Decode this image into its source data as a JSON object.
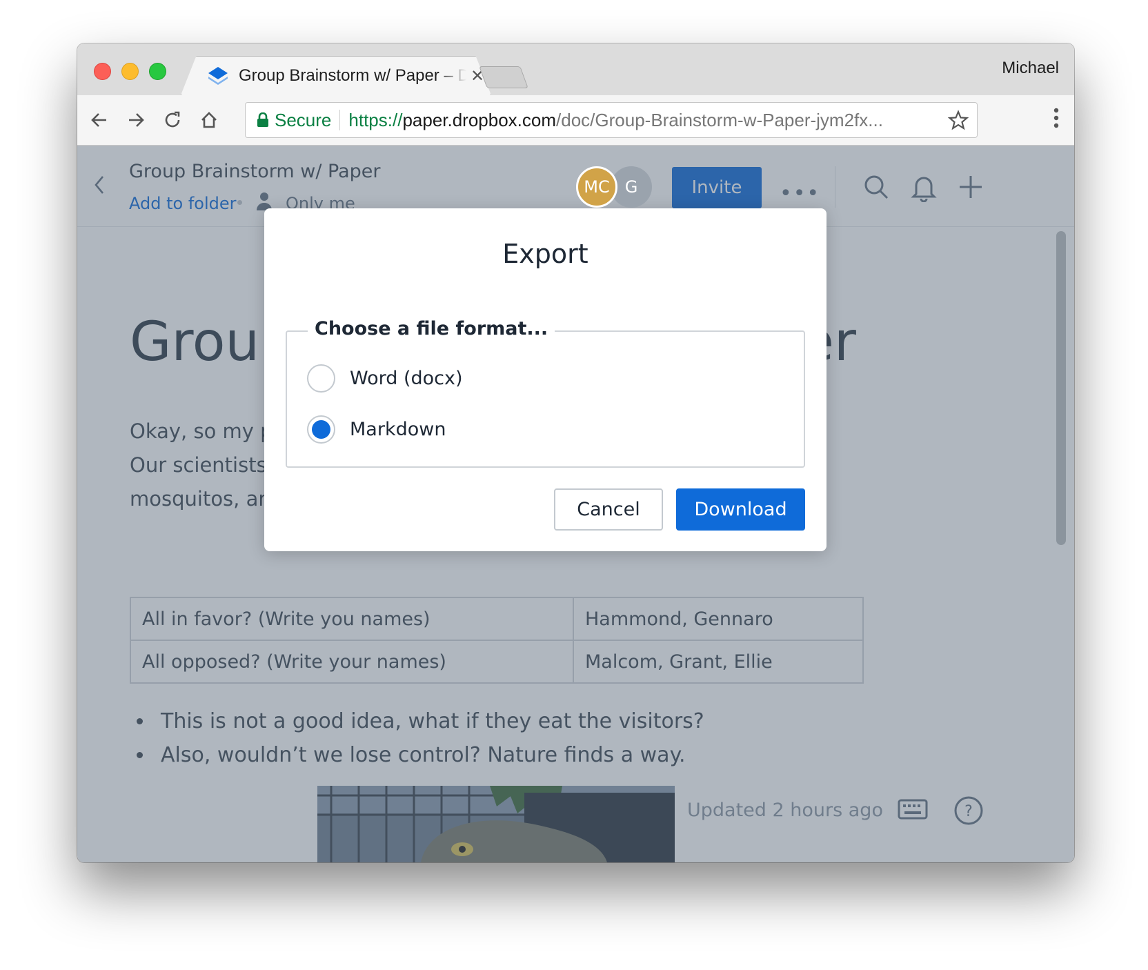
{
  "browser": {
    "tab_title": "Group Brainstorm w/ Paper – Dropbox Paper",
    "profile_name": "Michael",
    "secure_label": "Secure",
    "url_scheme": "https://",
    "url_host": "paper.dropbox.com",
    "url_path": "/doc/Group-Brainstorm-w-Paper-jym2fx..."
  },
  "app": {
    "doc_title": "Group Brainstorm w/ Paper",
    "add_to_folder": "Add to folder",
    "sharing": "Only me",
    "avatars": [
      "MC",
      "G"
    ],
    "invite_label": "Invite",
    "more_label": "•••"
  },
  "document": {
    "heading": "Group Brainstorm w/ Paper",
    "paragraph_lines": [
      "Okay, so my proposal is to bring back the dinosaurs.",
      "Our scientists have extracted DNA from fossilized",
      "mosquitos, and we can do it."
    ],
    "table": [
      [
        "All in favor? (Write you names)",
        "Hammond, Gennaro"
      ],
      [
        "All opposed? (Write your names)",
        "Malcom, Grant, Ellie"
      ]
    ],
    "bullets": [
      "This is not a good idea, what if they eat the visitors?",
      "Also, wouldn’t we lose control? Nature finds a way."
    ],
    "updated": "Updated 2 hours ago"
  },
  "dialog": {
    "title": "Export",
    "legend": "Choose a file format...",
    "options": [
      {
        "label": "Word (docx)",
        "selected": false
      },
      {
        "label": "Markdown",
        "selected": true
      }
    ],
    "cancel_label": "Cancel",
    "download_label": "Download"
  },
  "colors": {
    "accent": "#0f6bd9",
    "secure_green": "#0b8043"
  }
}
